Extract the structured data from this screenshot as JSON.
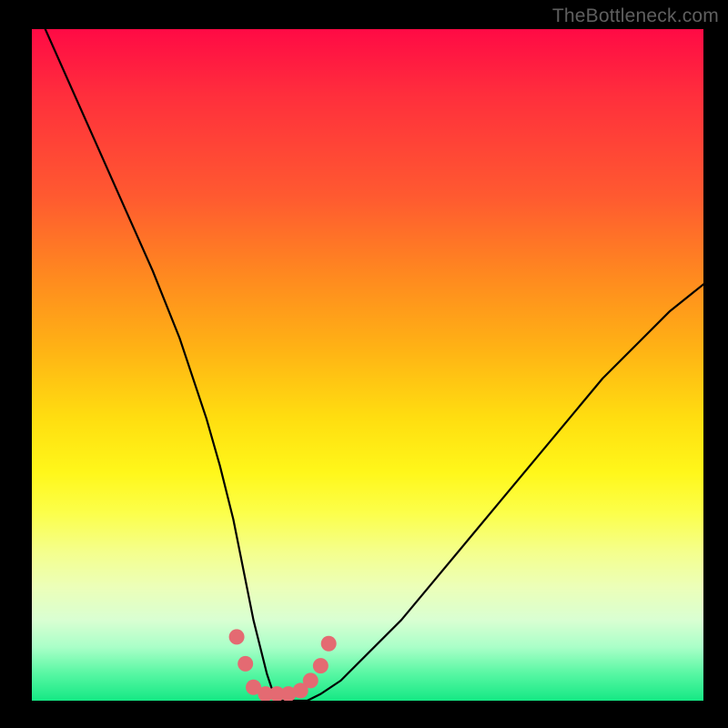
{
  "watermark": "TheBottleneck.com",
  "chart_data": {
    "type": "line",
    "title": "",
    "xlabel": "",
    "ylabel": "",
    "xlim": [
      0,
      100
    ],
    "ylim": [
      0,
      100
    ],
    "series": [
      {
        "name": "bottleneck-curve",
        "x": [
          2,
          6,
          10,
          14,
          18,
          22,
          26,
          28,
          30,
          31,
          32,
          33,
          34,
          35,
          36,
          37,
          38,
          39,
          40,
          41,
          43,
          46,
          50,
          55,
          60,
          65,
          70,
          75,
          80,
          85,
          90,
          95,
          100
        ],
        "y": [
          100,
          91,
          82,
          73,
          64,
          54,
          42,
          35,
          27,
          22,
          17,
          12,
          8,
          4,
          1,
          0,
          0,
          0,
          0,
          0,
          1,
          3,
          7,
          12,
          18,
          24,
          30,
          36,
          42,
          48,
          53,
          58,
          62
        ]
      }
    ],
    "markers": {
      "name": "highlight-dots",
      "color": "#e46a72",
      "points_xy": [
        [
          30.5,
          9.5
        ],
        [
          31.8,
          5.5
        ],
        [
          33.0,
          2.0
        ],
        [
          34.8,
          1.0
        ],
        [
          36.5,
          1.0
        ],
        [
          38.2,
          1.0
        ],
        [
          40.0,
          1.5
        ],
        [
          41.5,
          3.0
        ],
        [
          43.0,
          5.2
        ],
        [
          44.2,
          8.5
        ]
      ]
    },
    "gradient_stops": [
      {
        "pos": 0.0,
        "color": "#ff0a45"
      },
      {
        "pos": 0.1,
        "color": "#ff2f3c"
      },
      {
        "pos": 0.25,
        "color": "#ff5a30"
      },
      {
        "pos": 0.37,
        "color": "#ff8a1f"
      },
      {
        "pos": 0.47,
        "color": "#ffb015"
      },
      {
        "pos": 0.58,
        "color": "#ffde10"
      },
      {
        "pos": 0.66,
        "color": "#fff71a"
      },
      {
        "pos": 0.72,
        "color": "#fcff4a"
      },
      {
        "pos": 0.78,
        "color": "#f4ff8e"
      },
      {
        "pos": 0.83,
        "color": "#ecffb8"
      },
      {
        "pos": 0.88,
        "color": "#d9ffd2"
      },
      {
        "pos": 0.92,
        "color": "#aaffc8"
      },
      {
        "pos": 0.96,
        "color": "#57f7a3"
      },
      {
        "pos": 1.0,
        "color": "#15e884"
      }
    ]
  }
}
